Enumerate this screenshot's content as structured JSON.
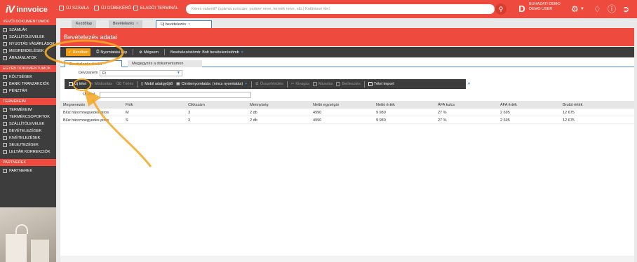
{
  "brand": {
    "name": "innvoice",
    "mark": "iV",
    "accent": "#ef4a3e",
    "dark": "#3c3c3c",
    "link": "#3f83d3",
    "highlight": "#f39c12"
  },
  "topbar": {
    "links": [
      {
        "label": "ÚJ SZÁMLA",
        "icon": "edit-icon"
      },
      {
        "label": "ÚJ DÍJBEKÉRŐ",
        "icon": "edit-icon"
      },
      {
        "label": "ELADÓI TERMINÁL",
        "icon": "terminal-icon"
      }
    ],
    "search_placeholder": "Keres valamit? (számla sorszám, partner neve, termék neve, stb.) Kattintson ide!",
    "avatar_letter": "D",
    "user_line1": "BUHAZATI DEMO",
    "user_line2": "DEMO USER"
  },
  "sidebar": {
    "sections": [
      {
        "title": "VEVŐI DOKUMENTUMOK",
        "items": [
          "SZÁMLÁK",
          "SZÁLLÍTÓLEVELEK",
          "NYUGTÁS VÁSÁRLÁSOK",
          "MEGRENDELÉSEK",
          "ÁRAJÁNLATOK"
        ]
      },
      {
        "title": "EGYÉB DOKUMENTUMOK",
        "items": [
          "KÖLTSÉGEK",
          "BANKI TRANZAKCIÓK",
          "PÉNZTÁR"
        ]
      },
      {
        "title": "TERMÉKEIM",
        "items": [
          "TERMÉKEIM",
          "TERMÉKCSOPORTOK",
          "SZÁLLÍTÓLEVELEK",
          "BEVÉTELEZÉSEK",
          "KIVÉTELEZÉSEK",
          "SELEJTEZÉSEK",
          "LELTÁR KORREKCIÓK"
        ]
      },
      {
        "title": "PARTNEREK",
        "items": [
          "PARTNEREK"
        ]
      }
    ]
  },
  "tabs": [
    {
      "label": "Kezdőlap"
    },
    {
      "label": "Bevételezés"
    },
    {
      "label": "Új bevételezés"
    }
  ],
  "page": {
    "title": "Bevételezés adatai"
  },
  "toolbar": {
    "save": "Rendben",
    "print": "Nyomtatási kép",
    "cancel": "Mégsem",
    "block": "Bevételezéstömb: Bolt bevételezéstömb"
  },
  "subtabs": [
    {
      "label": "Bevételezés tételei"
    },
    {
      "label": "Megjegyzés a dokumentumon"
    }
  ],
  "form": {
    "currency_label": "Devizanem",
    "currency_value": "Ft",
    "item_label": "Új tétel"
  },
  "item_toolbar": {
    "new": "Új tétel",
    "edit": "Módosítás",
    "delete": "Törlés",
    "mobile": "Mobil adatgyűjtő",
    "label_print": "Címkenyomtatás: (nincs nyomtatás)",
    "merge": "Összefésülés",
    "cut": "Kivágás",
    "copy": "Másolás",
    "paste": "Beillesztés",
    "import": "Tétel import"
  },
  "table": {
    "columns": [
      "Megnevezés",
      "Fiók",
      "Cikkszám",
      "Mennyiség",
      "Nettó egységár",
      "Nettó érték",
      "ÁFA kulcs",
      "ÁFA érték",
      "Bruttó érték"
    ],
    "rows": [
      [
        "Blúz háromnegyedes piros",
        "M",
        "3",
        "2 db",
        "4990",
        "9 980",
        "27 %",
        "2 695",
        "12 675"
      ],
      [
        "Blúz háromnegyedes piros",
        "S",
        "3",
        "2 db",
        "4990",
        "9 980",
        "27 %",
        "2 695",
        "12 675"
      ]
    ]
  }
}
